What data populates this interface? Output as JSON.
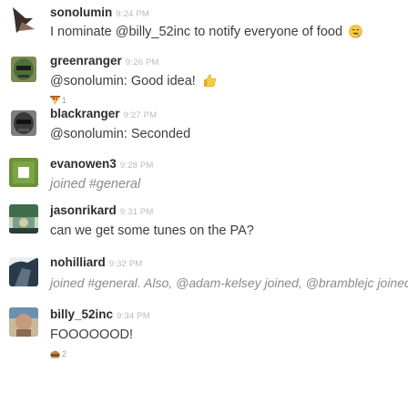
{
  "messages": [
    {
      "user": "sonolumin",
      "time": "9:24 PM",
      "text": "I nominate @billy_52inc to notify everyone of food",
      "emoji": "drooling-face-icon"
    },
    {
      "user": "greenranger",
      "time": "9:26 PM",
      "text": "@sonolumin: Good idea!",
      "emoji": "thumbs-up-icon",
      "reaction": {
        "emoji": "pizza-icon",
        "count": "1"
      }
    },
    {
      "user": "blackranger",
      "time": "9:27 PM",
      "text": "@sonolumin: Seconded"
    },
    {
      "user": "evanowen3",
      "time": "9:28 PM",
      "text": "joined #general"
    },
    {
      "user": "jasonrikard",
      "time": "9:31 PM",
      "text": "can we get some tunes on the PA?"
    },
    {
      "user": "nohilliard",
      "time": "9:32 PM",
      "text": "joined #general. Also, @adam-kelsey joined, @bramblejc joined."
    },
    {
      "user": "billy_52inc",
      "time": "9:34 PM",
      "text": "FOOOOOOD!",
      "reaction": {
        "emoji": "burger-icon",
        "count": "2"
      }
    }
  ]
}
